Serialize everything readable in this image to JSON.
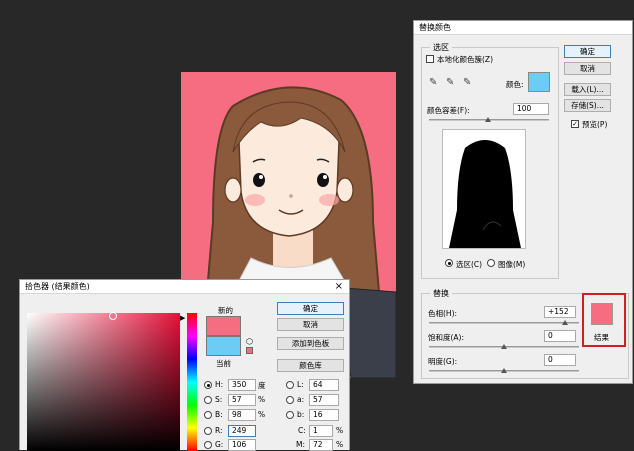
{
  "replace_dialog": {
    "title": "替换颜色",
    "selection_group": "选区",
    "localized_label": "本地化颜色簇(Z)",
    "color_label": "颜色:",
    "selection_color": "#6ecbf5",
    "fuzziness_label": "颜色容差(F):",
    "fuzziness_value": "100",
    "mode_selection": "选区(C)",
    "mode_image": "图像(M)",
    "replacement_group": "替换",
    "hue_label": "色相(H):",
    "hue_value": "+152",
    "saturation_label": "饱和度(A):",
    "saturation_value": "0",
    "lightness_label": "明度(G):",
    "lightness_value": "0",
    "result_label": "结果",
    "result_color": "#f66d82",
    "buttons": {
      "ok": "确定",
      "cancel": "取消",
      "load": "载入(L)...",
      "save": "存储(S)..."
    },
    "preview_label": "预览(P)"
  },
  "picker_dialog": {
    "title": "拾色器 (结果颜色)",
    "new_label": "新的",
    "current_label": "当前",
    "new_color": "#f66d82",
    "current_color": "#6ecbf5",
    "buttons": {
      "ok": "确定",
      "cancel": "取消",
      "add_swatch": "添加到色板",
      "libraries": "颜色库"
    },
    "hsb": [
      {
        "label": "H:",
        "value": "350",
        "unit": "度"
      },
      {
        "label": "S:",
        "value": "57",
        "unit": "%"
      },
      {
        "label": "B:",
        "value": "98",
        "unit": "%"
      }
    ],
    "rgb": [
      {
        "label": "R:",
        "value": "249"
      },
      {
        "label": "G:",
        "value": "106"
      }
    ],
    "lab": [
      {
        "label": "L:",
        "value": "64"
      },
      {
        "label": "a:",
        "value": "57"
      },
      {
        "label": "b:",
        "value": "16"
      }
    ],
    "cmyk": [
      {
        "label": "C:",
        "value": "1",
        "unit": "%"
      },
      {
        "label": "M:",
        "value": "72",
        "unit": "%"
      }
    ]
  }
}
